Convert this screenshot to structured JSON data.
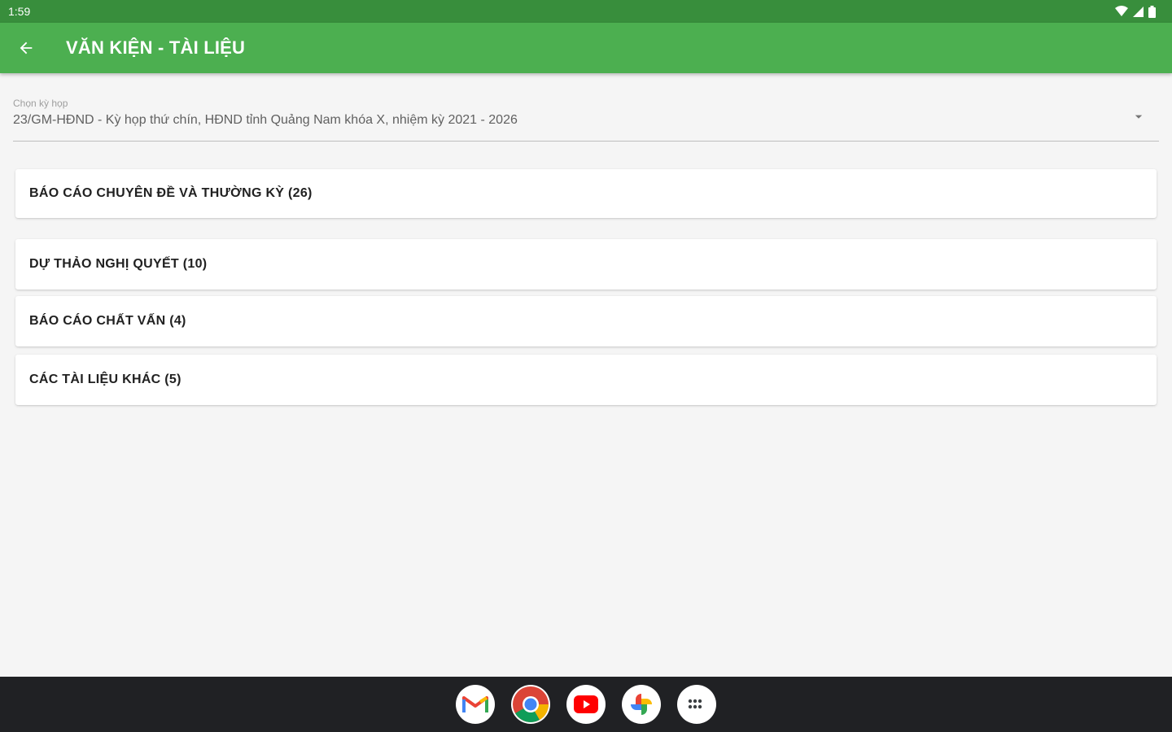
{
  "status_bar": {
    "time": "1:59"
  },
  "app_bar": {
    "title": "VĂN KIỆN - TÀI LIỆU"
  },
  "picker": {
    "label": "Chọn kỳ họp",
    "value": "23/GM-HĐND - Kỳ họp thứ chín, HĐND tỉnh Quảng Nam khóa X, nhiệm kỳ 2021 - 2026"
  },
  "categories": [
    {
      "label": "BÁO CÁO CHUYÊN ĐỀ VÀ THƯỜNG KỲ (26)"
    },
    {
      "label": "DỰ THẢO NGHỊ QUYẾT (10)"
    },
    {
      "label": "BÁO CÁO CHẤT VẤN (4)"
    },
    {
      "label": "CÁC TÀI LIỆU KHÁC (5)"
    }
  ],
  "dock": [
    {
      "icon": "gmail-icon"
    },
    {
      "icon": "chrome-icon"
    },
    {
      "icon": "youtube-icon"
    },
    {
      "icon": "photos-icon"
    },
    {
      "icon": "app-drawer-icon"
    }
  ],
  "colors": {
    "status_bar": "#388e3c",
    "app_bar": "#4caf50",
    "background": "#f5f5f5",
    "nav_bar": "#202124"
  }
}
